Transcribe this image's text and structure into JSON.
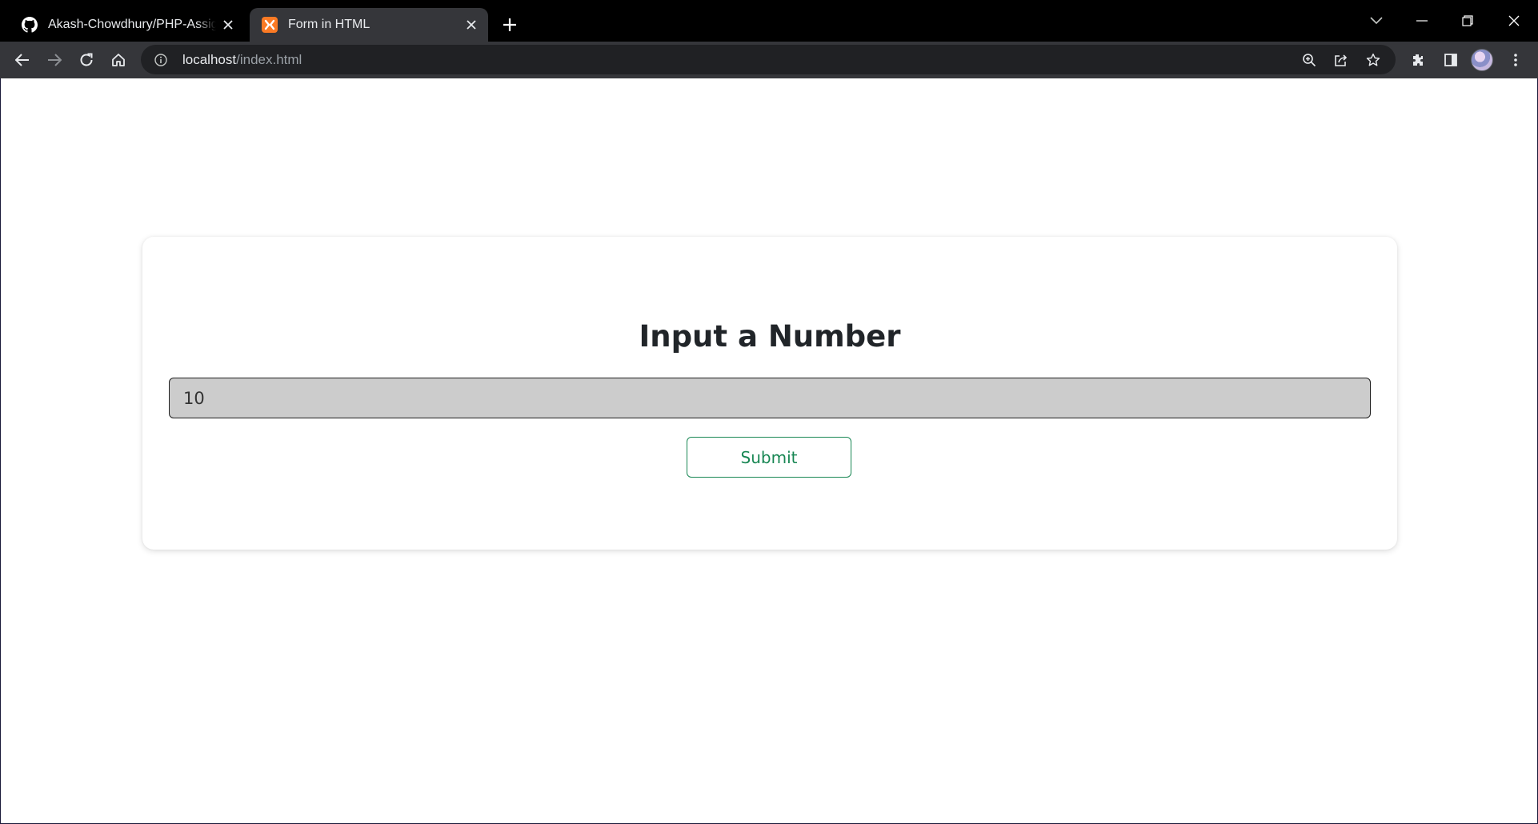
{
  "browser": {
    "tabs": [
      {
        "title": "Akash-Chowdhury/PHP-Assignm",
        "favicon": "github-icon",
        "active": false
      },
      {
        "title": "Form in HTML",
        "favicon": "xampp-icon",
        "active": true
      }
    ],
    "url": {
      "host": "localhost",
      "path": "/index.html"
    },
    "toolbar_icons": [
      "back-icon",
      "forward-icon",
      "reload-icon",
      "home-icon",
      "info-icon",
      "zoom-icon",
      "share-icon",
      "star-icon",
      "extensions-icon",
      "side-panel-icon",
      "avatar",
      "menu-icon"
    ],
    "window_controls": [
      "tab-search-icon",
      "minimize-icon",
      "restore-icon",
      "close-icon"
    ]
  },
  "page": {
    "heading": "Input a Number",
    "input": {
      "value": "10",
      "placeholder": ""
    },
    "submit_label": "Submit"
  },
  "colors": {
    "tabbar_bg": "#000000",
    "toolbar_bg": "#35363a",
    "omnibox_bg": "#202124",
    "input_bg": "#cccccc",
    "submit_accent": "#198754",
    "heading_text": "#212529"
  }
}
